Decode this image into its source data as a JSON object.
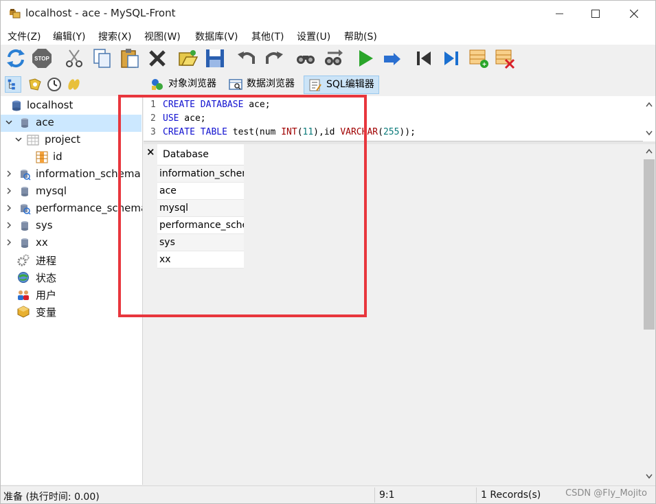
{
  "window": {
    "title": "localhost - ace - MySQL-Front"
  },
  "menu": [
    "文件(Z)",
    "编辑(Y)",
    "搜索(X)",
    "视图(W)",
    "数据库(V)",
    "其他(T)",
    "设置(U)",
    "帮助(S)"
  ],
  "toolbar": {
    "icons": [
      "refresh-icon",
      "stop-icon",
      "cut-icon",
      "copy-icon",
      "paste-icon",
      "delete-icon",
      "open-icon",
      "save-icon",
      "undo-icon",
      "redo-icon",
      "find-icon",
      "replace-icon",
      "run-icon",
      "run-step-icon",
      "first-icon",
      "last-icon",
      "insert-row-icon",
      "delete-row-icon"
    ]
  },
  "views": {
    "object_browser": "对象浏览器",
    "data_browser": "数据浏览器",
    "sql_editor": "SQL编辑器",
    "active": "sql_editor"
  },
  "tree": {
    "items": [
      {
        "label": "localhost",
        "icon": "server-icon",
        "level": 0,
        "expand": "none"
      },
      {
        "label": "ace",
        "icon": "database-icon",
        "level": 0,
        "expand": "expanded",
        "selected": true
      },
      {
        "label": "project",
        "icon": "table-icon",
        "level": 1,
        "expand": "expanded"
      },
      {
        "label": "id",
        "icon": "field-icon",
        "level": 2,
        "expand": "none"
      },
      {
        "label": "information_schema",
        "icon": "system-database-icon",
        "level": 0,
        "expand": "collapsed"
      },
      {
        "label": "mysql",
        "icon": "database-icon",
        "level": 0,
        "expand": "collapsed"
      },
      {
        "label": "performance_schema",
        "icon": "system-database-icon",
        "level": 0,
        "expand": "collapsed"
      },
      {
        "label": "sys",
        "icon": "database-icon",
        "level": 0,
        "expand": "collapsed"
      },
      {
        "label": "xx",
        "icon": "database-icon",
        "level": 0,
        "expand": "collapsed"
      },
      {
        "label": "进程",
        "icon": "processes-icon",
        "level": 0,
        "expand": "none"
      },
      {
        "label": "状态",
        "icon": "status-icon",
        "level": 0,
        "expand": "none"
      },
      {
        "label": "用户",
        "icon": "users-icon",
        "level": 0,
        "expand": "none"
      },
      {
        "label": "变量",
        "icon": "variables-icon",
        "level": 0,
        "expand": "none"
      }
    ]
  },
  "editor": {
    "line_numbers": [
      "1",
      "2",
      "3"
    ],
    "lines": [
      {
        "kw1": "CREATE DATABASE",
        "rest": " ace;"
      },
      {
        "kw1": "USE",
        "rest": " ace;"
      },
      {
        "kw1": "CREATE TABLE",
        "rest": " test(num ",
        "fn1": "INT",
        "p1": "(",
        "n1": "11",
        "p2": "),id ",
        "fn2": "VARCHAR",
        "p3": "(",
        "n2": "255",
        "p4": "));"
      }
    ]
  },
  "results": {
    "close_label": "×",
    "column": "Database",
    "rows": [
      "information_schema",
      "ace",
      "mysql",
      "performance_schema",
      "sys",
      "xx"
    ]
  },
  "status": {
    "ready": "准备  (执行时间: 0.00)",
    "position": "9:1",
    "records": "1 Records(s)",
    "watermark": "CSDN @Fly_Mojito"
  }
}
